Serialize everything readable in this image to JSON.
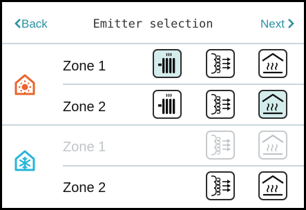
{
  "header": {
    "back_label": "Back",
    "title": "Emitter selection",
    "next_label": "Next"
  },
  "heating": {
    "icon": "heating-house-sun-icon",
    "color": "#e8642c",
    "zones": [
      {
        "label": "Zone 1",
        "enabled": true,
        "emitters": [
          "radiator",
          "fan-coil",
          "underfloor"
        ],
        "selected": "radiator"
      },
      {
        "label": "Zone 2",
        "enabled": true,
        "emitters": [
          "radiator",
          "fan-coil",
          "underfloor"
        ],
        "selected": "underfloor"
      }
    ]
  },
  "cooling": {
    "icon": "cooling-house-snowflake-icon",
    "color": "#27b4d8",
    "zones": [
      {
        "label": "Zone 1",
        "enabled": false,
        "emitters": [
          "fan-coil",
          "underfloor"
        ],
        "selected": null
      },
      {
        "label": "Zone 2",
        "enabled": true,
        "emitters": [
          "fan-coil",
          "underfloor"
        ],
        "selected": null
      }
    ]
  }
}
